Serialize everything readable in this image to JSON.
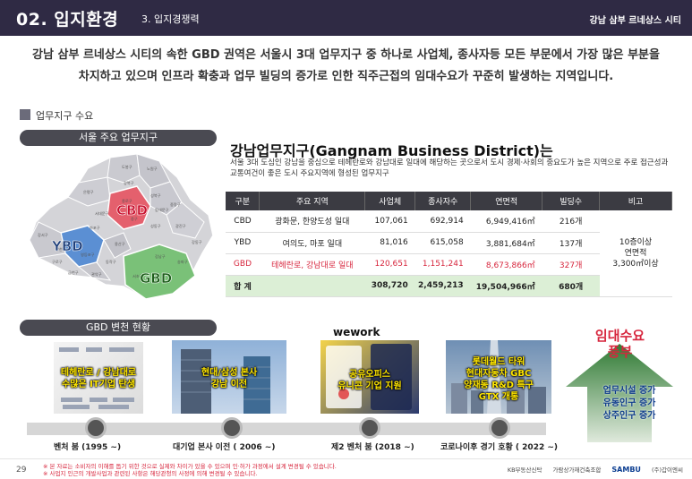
{
  "header": {
    "title": "02. 입지환경",
    "subtitle": "3. 입지경쟁력",
    "project": "강남 삼부 르네상스 시티"
  },
  "intro": {
    "line1": "강남 삼부 르네상스 시티의 속한 GBD 권역은 서울시 3대 업무지구 중 하나로 사업체, 종사자등 모든 부문에서 가장 많은 부분을",
    "line2": "차지하고 있으며 인프라 확충과 업무 빌딩의 증가로 인한 직주근접의  임대수요가 꾸준히 발생하는 지역입니다."
  },
  "section_label": "업무지구 수요",
  "map": {
    "pill": "서울 주요 업무지구",
    "labels": {
      "cbd": "CBD",
      "ybd": "YBD",
      "gbd": "GBD"
    },
    "districts": [
      "도봉구",
      "노원구",
      "강북구",
      "성북구",
      "은평구",
      "종로구",
      "중랑구",
      "동대문구",
      "서대문구",
      "중구",
      "성동구",
      "광진구",
      "마포구",
      "용산구",
      "강서구",
      "양천구",
      "영등포구",
      "동작구",
      "구로구",
      "관악구",
      "금천구",
      "서초구",
      "강남구",
      "송파구",
      "강동구"
    ],
    "colors": {
      "cbd": "#e4606d",
      "ybd": "#5b8fd3",
      "gbd": "#7ac178",
      "base": "#d4d4d8"
    }
  },
  "gbd": {
    "title": "강남업무지구(Gangnam Business District)는",
    "desc": "서울 3대 도심인 강남을 중심으로 테헤란로와 강남대로 일대에  해당하는 곳으로서 도시 경제·사회의 중요도가 높은 지역으로 주로 접근성과 교통여건이 좋은 도시 주요지역에 형성된 업무지구"
  },
  "table": {
    "headers": [
      "구분",
      "주요 지역",
      "사업체",
      "종사자수",
      "연면적",
      "빌딩수",
      "비고"
    ],
    "rows": [
      [
        "CBD",
        "광화문, 한양도성 일대",
        "107,061",
        "692,914",
        "6,949,416㎡",
        "216개"
      ],
      [
        "YBD",
        "여의도, 마포 일대",
        "81,016",
        "615,058",
        "3,881,684㎡",
        "137개"
      ],
      [
        "GBD",
        "테헤란로, 강남대로 일대",
        "120,651",
        "1,151,241",
        "8,673,866㎡",
        "327개"
      ]
    ],
    "total": [
      "합 계",
      "",
      "308,720",
      "2,459,213",
      "19,504,966㎡",
      "680개"
    ],
    "note": [
      "10층이상",
      "연면적",
      "3,300㎡이상"
    ]
  },
  "history": {
    "pill": "GBD 변천 현황",
    "photos": [
      [
        "테헤란로 / 강남대로",
        "수많은 IT기업 탄생"
      ],
      [
        "현대/삼성 본사",
        "강남 이전"
      ],
      [
        "공유오피스",
        "유니콘 기업 지원"
      ],
      [
        "롯데월드 타워",
        "현대자동차 GBC",
        "양재동 R&D 특구",
        "GTX 개통"
      ]
    ],
    "wework": "wework",
    "timeline": [
      "벤처 붐 (1995 ~)",
      "대기업 본사  이전 ( 2006 ~)",
      "제2 벤처 붐 (2018 ~)",
      "코로나이후 경기 호황 ( 2022 ~)"
    ],
    "rental": [
      "임대수요",
      "풍부"
    ],
    "growth": [
      "업무시설 증가",
      "유동인구 증가",
      "상주인구 증가"
    ]
  },
  "footer": {
    "page": "29",
    "notes": [
      "※ 본 자료는 소비자의 이해를 돕기 위한 것으로 실제와 차이가 있을 수 있으며 인·허가 과정에서 설계 변경될 수 있습니다.",
      "※ 사업지 인근의 개발사업과 관련된 사항은 해당관청의 사정에 의해 변경될 수 있습니다."
    ],
    "logos": [
      "KB부동산신탁",
      "가람상가재건축조합",
      "SAMBU",
      "(주)갑이엔씨"
    ]
  }
}
